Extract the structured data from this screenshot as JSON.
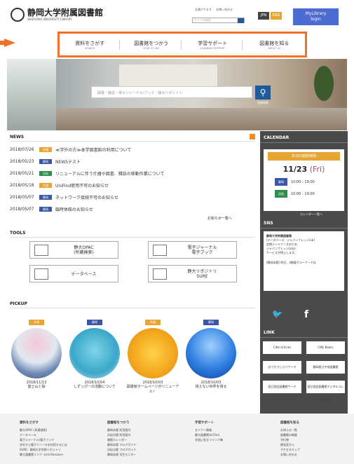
{
  "header": {
    "title": "静岡大学附属図書館",
    "subtitle": "SHIZUOKA UNIVERSITY LIBRARY",
    "links": [
      "交通アクセス",
      "お問い合わせ"
    ],
    "search_placeholder": "サイト内検索",
    "langs": [
      "JPN",
      "ENG"
    ],
    "mylibrary": [
      "MyLibrary",
      "login"
    ]
  },
  "nav": [
    {
      "label": "資料をさがす",
      "sub": "SEARCH"
    },
    {
      "label": "図書館をつかう",
      "sub": "HOW TO USE"
    },
    {
      "label": "学習サポート",
      "sub": "LEARNING SUPPORT"
    },
    {
      "label": "図書館を知る",
      "sub": "ABOUT US"
    }
  ],
  "hero": {
    "search_placeholder": "図書・雑誌・電子ジャーナル/ブック・静大リポジトリ",
    "advanced": "詳細検索"
  },
  "news": {
    "heading": "NEWS",
    "more": "お知らせ一覧へ",
    "items": [
      {
        "date": "2018/07/26",
        "tag": "共通",
        "tagtype": "common",
        "text": "≪学外の方≫本学図書館の利用について"
      },
      {
        "date": "2018/05/23",
        "tag": "静岡",
        "tagtype": "sogo",
        "text": "NEWSテスト"
      },
      {
        "date": "2018/05/21",
        "tag": "浜松",
        "tagtype": "hama",
        "text": "リニューアルに伴う什器や図書、雑誌の移動作業について"
      },
      {
        "date": "2018/05/18",
        "tag": "共通",
        "tagtype": "common",
        "text": "UniFind使用不可のお知らせ"
      },
      {
        "date": "2018/05/07",
        "tag": "静岡",
        "tagtype": "sogo",
        "text": "ネットワーク接続不可のお知らせ"
      },
      {
        "date": "2018/05/07",
        "tag": "静岡",
        "tagtype": "sogo",
        "text": "臨時休館のお知らせ"
      }
    ]
  },
  "tools": {
    "heading": "TOOLS",
    "items": [
      "静大OPAC\n(所蔵検索)",
      "電子ジャーナル\n電子ブック",
      "データベース",
      "静大リポジトリ\nSURE"
    ]
  },
  "pickup": {
    "heading": "PICKUP",
    "items": [
      {
        "tag": "共通",
        "tagtype": "common",
        "date": "2018/11/13",
        "title": "富士山と桜"
      },
      {
        "tag": "静岡",
        "tagtype": "sogo",
        "date": "2018/10/04",
        "title": "しずっぴーの活動について"
      },
      {
        "tag": "共通",
        "tagtype": "common",
        "date": "2018/10/03",
        "title": "図書館ホームページがリニューアル！"
      },
      {
        "tag": "静岡",
        "tagtype": "sogo",
        "date": "2018/10/03",
        "title": "視えない世界を視る"
      }
    ]
  },
  "calendar": {
    "heading": "CALENDAR",
    "label": "本日の開館時間",
    "date": "11/23",
    "day": "(Fri)",
    "rows": [
      {
        "tag": "静岡",
        "tagtype": "sogo",
        "time": "10:00 - 19:00"
      },
      {
        "tag": "浜松",
        "tagtype": "hama",
        "time": "10:00 - 19:00"
      }
    ],
    "more": "カレンダー一覧へ"
  },
  "sns": {
    "heading": "SNS",
    "account": "静岡大学附属図書館",
    "lines": [
      "[データベース：ジャパンナレッジLib]",
      "定期メンテナンスのため、",
      "ジャパンナレッジLibの",
      "サービスが停止します。",
      "[静岡本館] 明日、4階電子コーナーでは"
    ]
  },
  "link": {
    "heading": "LINK",
    "items": [
      "CiNii Articles",
      "CiNii Books",
      "おうちでしらベサーチ",
      "静岡県立中央図書館",
      "国立国会図書館サーチ",
      "国立国会図書館デジタルコレクション"
    ]
  },
  "footer": [
    {
      "heading": "資料をさがす",
      "items": [
        "静大OPAC (所蔵検索)",
        "データベース",
        "電子ジャーナル/電子ブック",
        "学外から電子リソースを利用するには",
        "SURE：静岡大学学術リポジトリ",
        "静大図書館リンク -Link Resolver-"
      ]
    },
    {
      "heading": "図書館をつかう",
      "items": [
        "静岡本館 利用案内",
        "浜松分館 利用案内",
        "開館カレンダー",
        "静岡本館 フロアガイド",
        "浜松分館 フロアガイド",
        "静岡本館 学生モニター"
      ]
    },
    {
      "heading": "学習サポート",
      "items": [
        "セミナー情報",
        "静大図書館UniFind",
        "学習に役立つリンク集"
      ]
    },
    {
      "heading": "図書館を知る",
      "items": [
        "お知らせ一覧",
        "図書館の概要",
        "刊行物",
        "館長室から",
        "アクセスマップ",
        "お問い合わせ"
      ]
    }
  ],
  "colors": {
    "accent": "#f0722a",
    "blue": "#1f5a9c",
    "orange": "#e8a533",
    "green": "#2f8f4a",
    "navy": "#3b57a8"
  }
}
